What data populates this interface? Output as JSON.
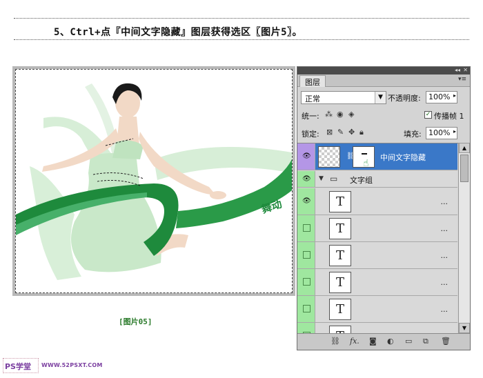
{
  "header": {
    "step_text": "5、Ctrl+点『中间文字隐藏』图层获得选区〖图片5〗。"
  },
  "figure": {
    "caption": "[图片05]",
    "watermark_text": "舞动"
  },
  "watermark": {
    "logo": "PS学堂",
    "url": "WWW.52PSXT.COM"
  },
  "panel": {
    "tab": "图层",
    "blend_mode": "正常",
    "opacity_label": "不透明度:",
    "opacity_value": "100%",
    "unify_label": "统一:",
    "propagate_label": "传播帧 1",
    "lock_label": "锁定:",
    "fill_label": "填充:",
    "fill_value": "100%",
    "layers": [
      {
        "name": "中间文字隐藏",
        "type": "masked",
        "selected": true
      },
      {
        "name": "文字组",
        "type": "group"
      },
      {
        "name": "",
        "type": "text",
        "suffix": "..."
      },
      {
        "name": "",
        "type": "text",
        "suffix": "..."
      },
      {
        "name": "",
        "type": "text",
        "suffix": "..."
      },
      {
        "name": "",
        "type": "text",
        "suffix": "..."
      },
      {
        "name": "",
        "type": "text",
        "suffix": "..."
      },
      {
        "name": "",
        "type": "text",
        "suffix": "..."
      }
    ],
    "text_glyph": "T"
  },
  "colors": {
    "selection": "#3a78c8",
    "eye_cell": "#9fe79f",
    "ribbon_dark": "#1e8a3c",
    "ribbon_light": "#cfe9cf"
  }
}
